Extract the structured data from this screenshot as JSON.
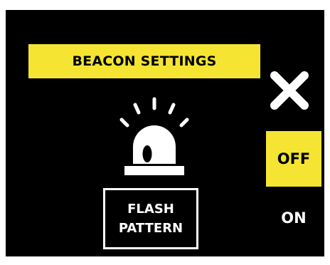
{
  "header": {
    "title": "BEACON SETTINGS"
  },
  "controls": {
    "flash_pattern_line1": "FLASH",
    "flash_pattern_line2": "PATTERN",
    "off_label": "OFF",
    "on_label": "ON",
    "selected": "OFF"
  },
  "icons": {
    "close": "close-icon",
    "beacon": "beacon-light-icon"
  },
  "colors": {
    "background": "#000000",
    "accent": "#f5e532",
    "foreground": "#ffffff"
  }
}
